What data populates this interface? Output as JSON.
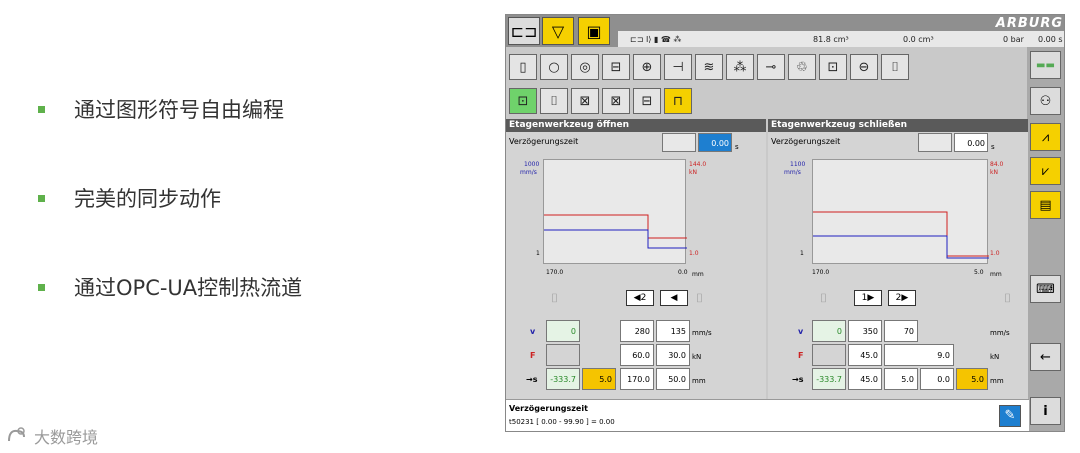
{
  "slide": {
    "bullets": [
      "通过图形符号自由编程",
      "完美的同步动作",
      "通过OPC-UA控制热流道"
    ],
    "logo_text": "大数跨境",
    "bullet_color": "#5fb14b"
  },
  "hmi": {
    "brand": "ARBURG",
    "status": {
      "v1": "81.8 cm³",
      "v2": "0.0 cm³",
      "v3": "0 bar",
      "v4": "0.00 s"
    },
    "left": {
      "title": "Etagenwerkzeug öffnen",
      "delay_label": "Verzögerungszeit",
      "delay_value": "0.00",
      "delay_unit": "s",
      "ytop": "1000",
      "yunit": "mm/s",
      "ybot": "1",
      "rtop": "144.0",
      "runit": "kN",
      "rbot": "1.0",
      "xleft": "170.0",
      "xright": "0.0",
      "xunit": "mm",
      "v": [
        "0",
        "280",
        "135"
      ],
      "v_unit": "mm/s",
      "f": [
        "",
        "60.0",
        "30.0"
      ],
      "f_unit": "kN",
      "s": [
        "-333.7",
        "5.0",
        "170.0",
        "50.0"
      ],
      "s_unit": "mm"
    },
    "right": {
      "title": "Etagenwerkzeug schließen",
      "delay_label": "Verzögerungszeit",
      "delay_value": "0.00",
      "delay_unit": "s",
      "ytop": "1100",
      "yunit": "mm/s",
      "ybot": "1",
      "rtop": "84.0",
      "runit": "kN",
      "rbot": "1.0",
      "xleft": "170.0",
      "xright": "5.0",
      "xunit": "mm",
      "v": [
        "0",
        "350",
        "70"
      ],
      "v_unit": "mm/s",
      "f": [
        "",
        "45.0",
        "9.0"
      ],
      "f_unit": "kN",
      "s": [
        "-333.7",
        "45.0",
        "5.0",
        "0.0",
        "5.0"
      ],
      "s_unit": "mm"
    },
    "row_labels": {
      "v": "v",
      "f": "F",
      "s": "s"
    },
    "footer": {
      "title": "Verzögerungszeit",
      "detail": "t50231 [ 0.00 - 99.90 ] = 0.00"
    }
  }
}
